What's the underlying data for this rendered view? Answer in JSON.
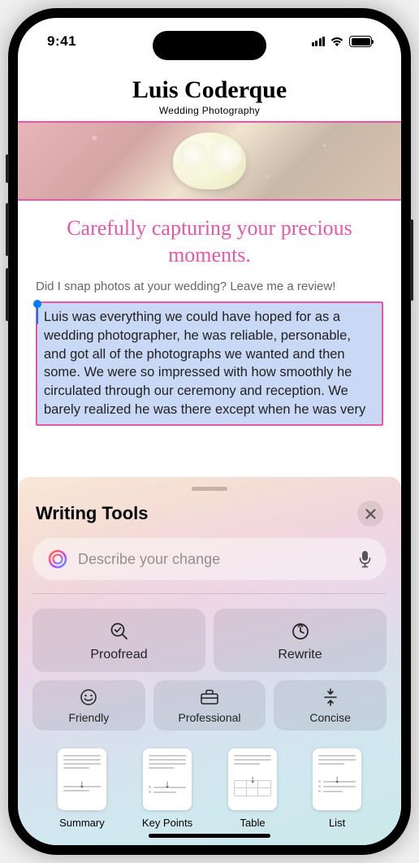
{
  "status": {
    "time": "9:41"
  },
  "doc": {
    "title": "Luis Coderque",
    "subtitle": "Wedding Photography",
    "tagline": "Carefully capturing your precious moments.",
    "review_prompt": "Did I snap photos at your wedding? Leave me a review!",
    "selected_text": "Luis was everything we could have hoped for as a wedding photographer, he was reliable, personable, and got all of the photographs we wanted and then some. We were so impressed with how smoothly he circulated through our ceremony and reception. We barely realized he was there except when he was very"
  },
  "sheet": {
    "title": "Writing Tools",
    "prompt_placeholder": "Describe your change",
    "actions": {
      "proofread": "Proofread",
      "rewrite": "Rewrite",
      "friendly": "Friendly",
      "professional": "Professional",
      "concise": "Concise"
    },
    "formats": {
      "summary": "Summary",
      "key_points": "Key Points",
      "table": "Table",
      "list": "List"
    }
  }
}
